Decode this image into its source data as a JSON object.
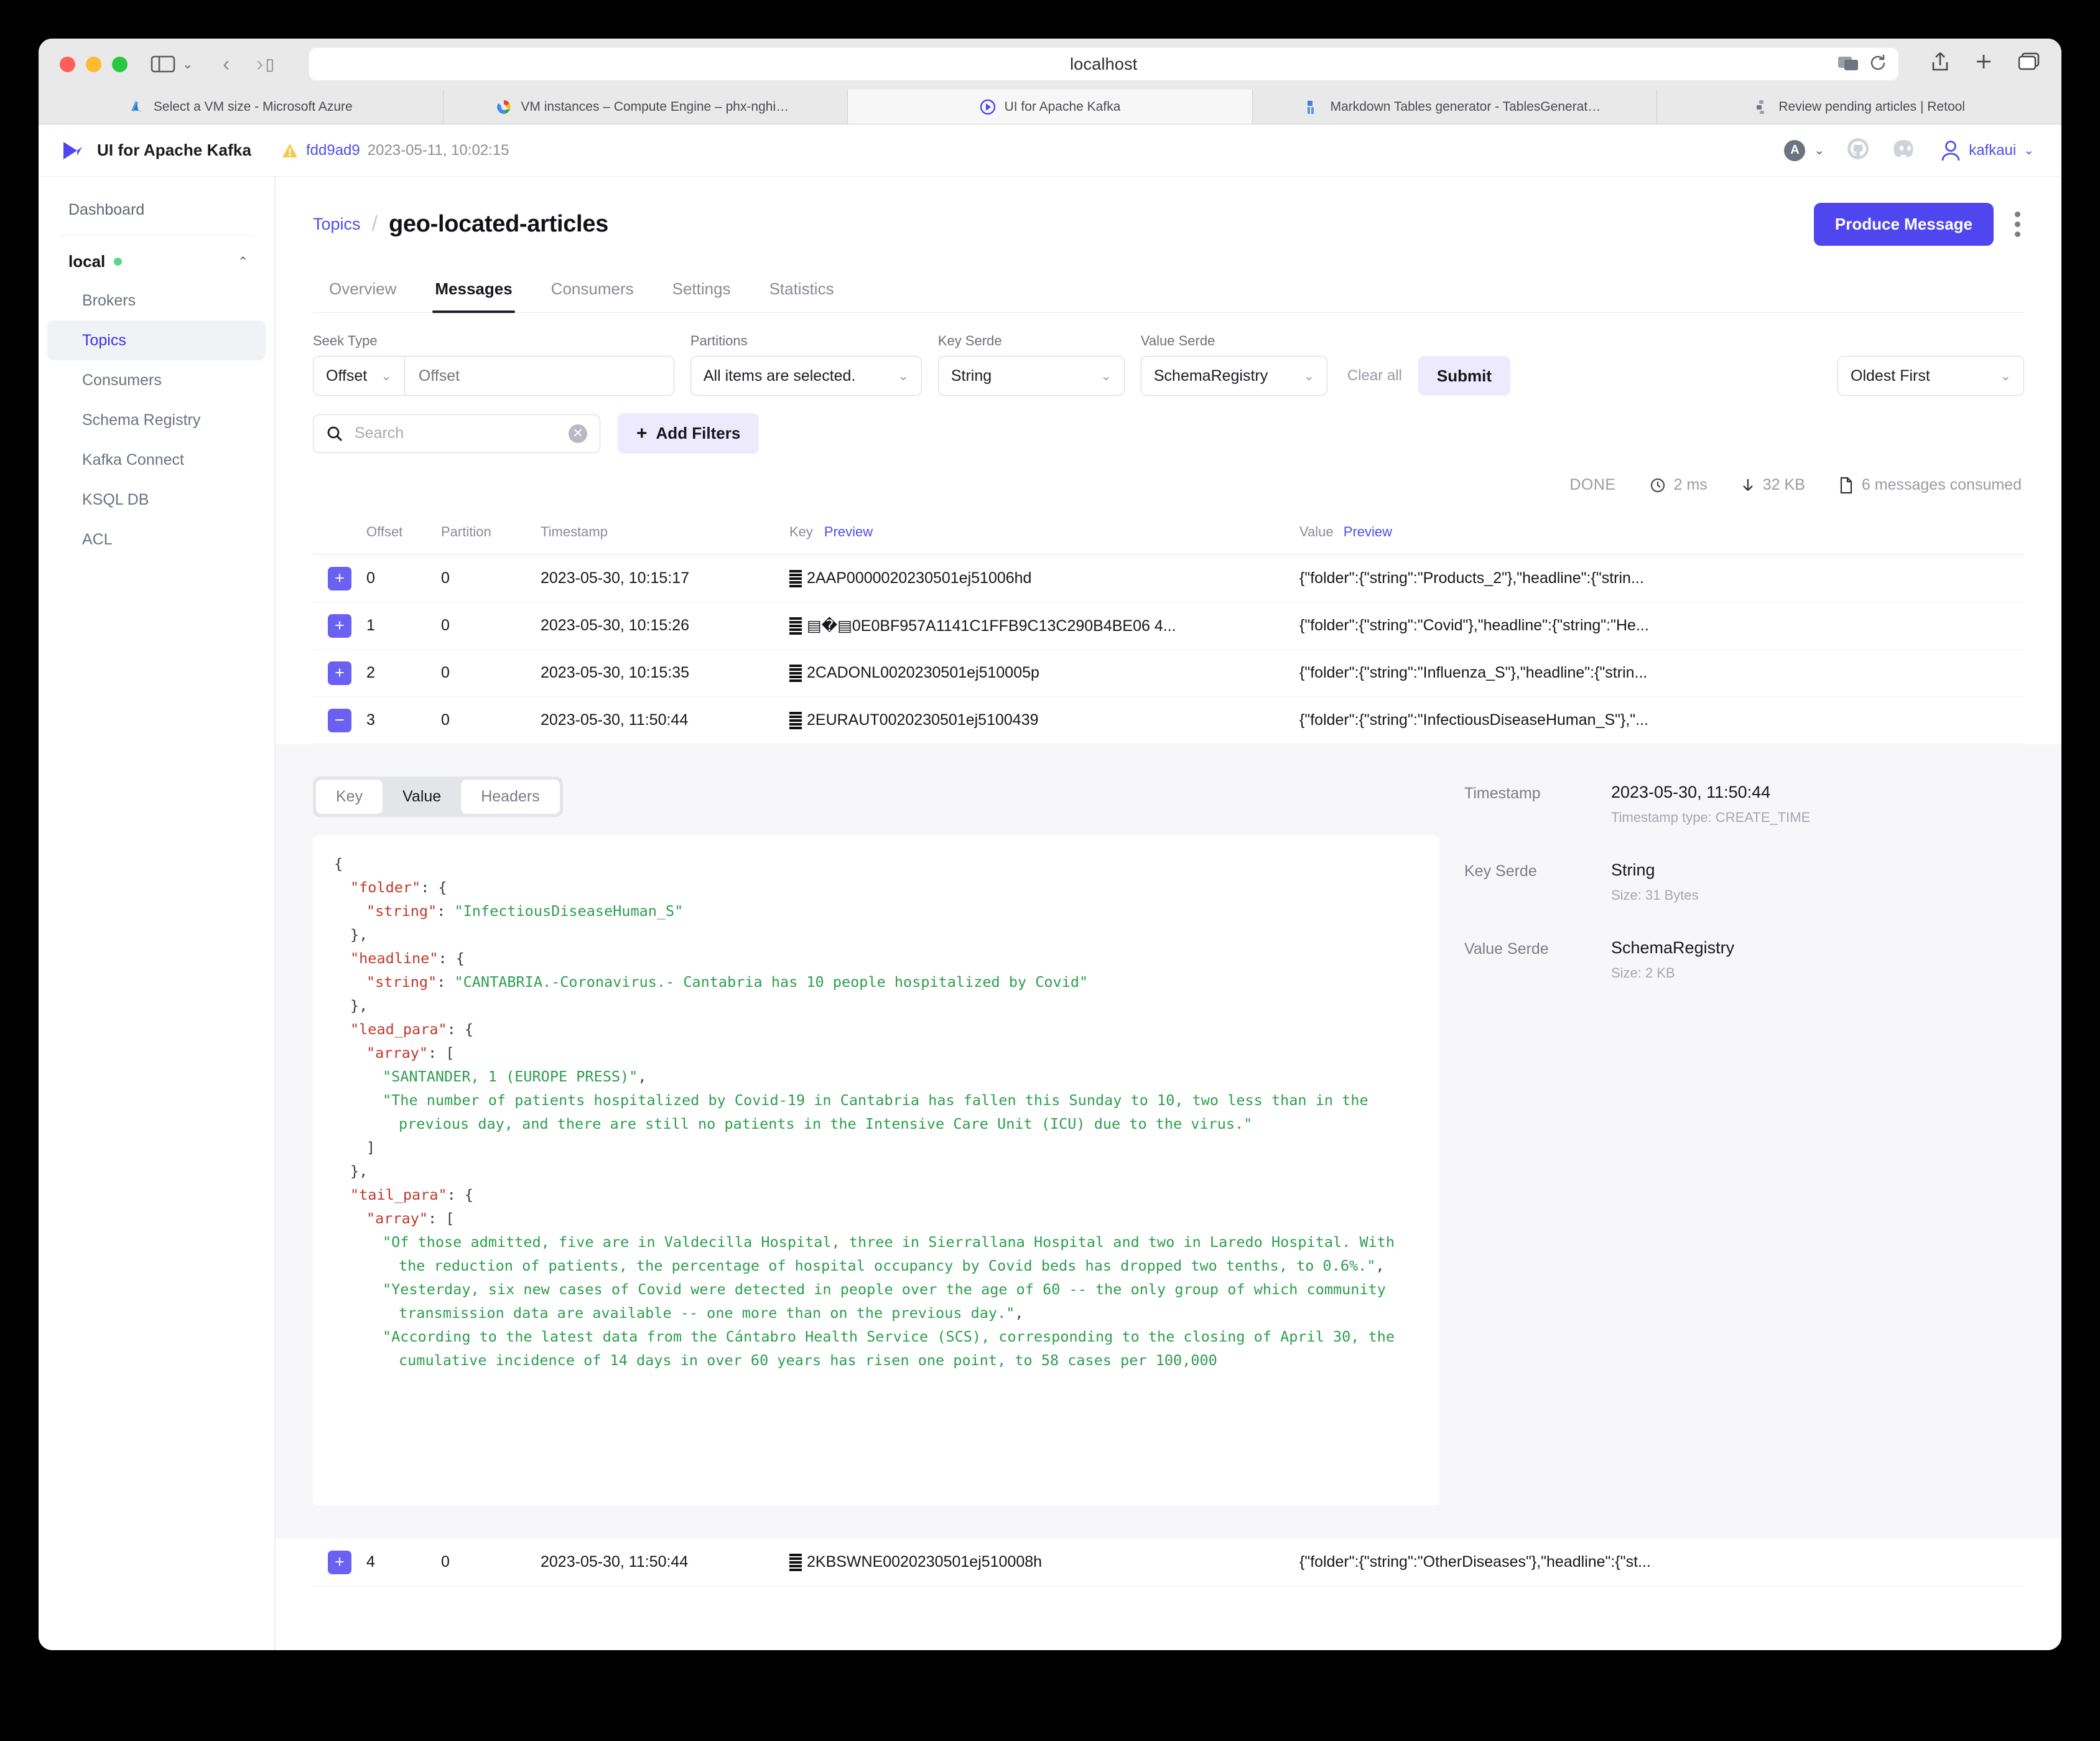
{
  "browser": {
    "url": "localhost",
    "tabs": [
      {
        "label": "Select a VM size - Microsoft Azure",
        "icon": "azure-icon",
        "active": false
      },
      {
        "label": "VM instances – Compute Engine – phx-nghiad...",
        "icon": "gcp-icon",
        "active": false
      },
      {
        "label": "UI for Apache Kafka",
        "icon": "kafka-ui-icon",
        "active": true
      },
      {
        "label": "Markdown Tables generator - TablesGenerator...",
        "icon": "tables-icon",
        "active": false
      },
      {
        "label": "Review pending articles | Retool",
        "icon": "retool-icon",
        "active": false
      }
    ]
  },
  "header": {
    "brand": "UI for Apache Kafka",
    "version_hash": "fdd9ad9",
    "version_date": "2023-05-11, 10:02:15",
    "avatar_letter": "A",
    "user": "kafkaui"
  },
  "sidebar": {
    "dashboard": "Dashboard",
    "cluster": "local",
    "items": [
      {
        "label": "Brokers",
        "active": false
      },
      {
        "label": "Topics",
        "active": true
      },
      {
        "label": "Consumers",
        "active": false
      },
      {
        "label": "Schema Registry",
        "active": false
      },
      {
        "label": "Kafka Connect",
        "active": false
      },
      {
        "label": "KSQL DB",
        "active": false
      },
      {
        "label": "ACL",
        "active": false
      }
    ]
  },
  "breadcrumb": {
    "parent": "Topics",
    "title": "geo-located-articles",
    "produce_label": "Produce Message"
  },
  "tabs": [
    {
      "label": "Overview",
      "active": false
    },
    {
      "label": "Messages",
      "active": true
    },
    {
      "label": "Consumers",
      "active": false
    },
    {
      "label": "Settings",
      "active": false
    },
    {
      "label": "Statistics",
      "active": false
    }
  ],
  "filters": {
    "seek_type_label": "Seek Type",
    "seek_type_value": "Offset",
    "seek_offset_placeholder": "Offset",
    "seek_offset_value": "",
    "partitions_label": "Partitions",
    "partitions_value": "All items are selected.",
    "key_serde_label": "Key Serde",
    "key_serde_value": "String",
    "value_serde_label": "Value Serde",
    "value_serde_value": "SchemaRegistry",
    "clear_all": "Clear all",
    "submit": "Submit",
    "sort_value": "Oldest First",
    "search_placeholder": "Search",
    "search_value": "",
    "add_filters": "Add Filters"
  },
  "status": {
    "state": "DONE",
    "elapsed": "2 ms",
    "bytes": "32 KB",
    "messages": "6 messages consumed"
  },
  "table": {
    "columns": {
      "offset": "Offset",
      "partition": "Partition",
      "timestamp": "Timestamp",
      "key": "Key",
      "key_preview": "Preview",
      "value": "Value",
      "value_preview": "Preview"
    },
    "rows": [
      {
        "offset": "0",
        "partition": "0",
        "timestamp": "2023-05-30, 10:15:17",
        "key": "2AAP0000020230501ej51006hd",
        "value": "{\"folder\":{\"string\":\"Products_2\"},\"headline\":{\"strin...",
        "expanded": false
      },
      {
        "offset": "1",
        "partition": "0",
        "timestamp": "2023-05-30, 10:15:26",
        "key": "▤�▤0E0BF957A1141C1FFB9C13C290B4BE06 4...",
        "value": "{\"folder\":{\"string\":\"Covid\"},\"headline\":{\"string\":\"He...",
        "expanded": false
      },
      {
        "offset": "2",
        "partition": "0",
        "timestamp": "2023-05-30, 10:15:35",
        "key": "2CADONL0020230501ej510005p",
        "value": "{\"folder\":{\"string\":\"Influenza_S\"},\"headline\":{\"strin...",
        "expanded": false
      },
      {
        "offset": "3",
        "partition": "0",
        "timestamp": "2023-05-30, 11:50:44",
        "key": "2EURAUT0020230501ej5100439",
        "value": "{\"folder\":{\"string\":\"InfectiousDiseaseHuman_S\"},\"...",
        "expanded": true
      },
      {
        "offset": "4",
        "partition": "0",
        "timestamp": "2023-05-30, 11:50:44",
        "key": "2KBSWNE0020230501ej510008h",
        "value": "{\"folder\":{\"string\":\"OtherDiseases\"},\"headline\":{\"st...",
        "expanded": false
      }
    ]
  },
  "detail": {
    "segments": [
      {
        "label": "Key",
        "active": false
      },
      {
        "label": "Value",
        "active": true
      },
      {
        "label": "Headers",
        "active": false
      }
    ],
    "json_lines": [
      {
        "indent": 0,
        "parts": [
          {
            "t": "{",
            "c": "p"
          }
        ]
      },
      {
        "indent": 1,
        "parts": [
          {
            "t": "\"folder\"",
            "c": "k"
          },
          {
            "t": ": {",
            "c": "p"
          }
        ]
      },
      {
        "indent": 2,
        "parts": [
          {
            "t": "\"string\"",
            "c": "k"
          },
          {
            "t": ": ",
            "c": "p"
          },
          {
            "t": "\"InfectiousDiseaseHuman_S\"",
            "c": "s"
          }
        ]
      },
      {
        "indent": 1,
        "parts": [
          {
            "t": "},",
            "c": "p"
          }
        ]
      },
      {
        "indent": 1,
        "parts": [
          {
            "t": "\"headline\"",
            "c": "k"
          },
          {
            "t": ": {",
            "c": "p"
          }
        ]
      },
      {
        "indent": 2,
        "parts": [
          {
            "t": "\"string\"",
            "c": "k"
          },
          {
            "t": ": ",
            "c": "p"
          },
          {
            "t": "\"CANTABRIA.-Coronavirus.- Cantabria has 10 people hospitalized by Covid\"",
            "c": "s"
          }
        ]
      },
      {
        "indent": 1,
        "parts": [
          {
            "t": "},",
            "c": "p"
          }
        ]
      },
      {
        "indent": 1,
        "parts": [
          {
            "t": "\"lead_para\"",
            "c": "k"
          },
          {
            "t": ": {",
            "c": "p"
          }
        ]
      },
      {
        "indent": 2,
        "parts": [
          {
            "t": "\"array\"",
            "c": "k"
          },
          {
            "t": ": [",
            "c": "p"
          }
        ]
      },
      {
        "indent": 3,
        "parts": [
          {
            "t": "\"SANTANDER, 1 (EUROPE PRESS)\"",
            "c": "s"
          },
          {
            "t": ",",
            "c": "p"
          }
        ]
      },
      {
        "indent": 3,
        "parts": [
          {
            "t": "\"The number of patients hospitalized by Covid-19 in Cantabria has fallen this Sunday to 10, two less than in the previous day, and there are still no patients in the Intensive Care Unit (ICU) due to the virus.\"",
            "c": "s"
          }
        ]
      },
      {
        "indent": 2,
        "parts": [
          {
            "t": "]",
            "c": "p"
          }
        ]
      },
      {
        "indent": 1,
        "parts": [
          {
            "t": "},",
            "c": "p"
          }
        ]
      },
      {
        "indent": 1,
        "parts": [
          {
            "t": "\"tail_para\"",
            "c": "k"
          },
          {
            "t": ": {",
            "c": "p"
          }
        ]
      },
      {
        "indent": 2,
        "parts": [
          {
            "t": "\"array\"",
            "c": "k"
          },
          {
            "t": ": [",
            "c": "p"
          }
        ]
      },
      {
        "indent": 3,
        "parts": [
          {
            "t": "\"Of those admitted, five are in Valdecilla Hospital, three in Sierrallana Hospital and two in Laredo Hospital. With the reduction of patients, the percentage of hospital occupancy by Covid beds has dropped two tenths, to 0.6%.\"",
            "c": "s"
          },
          {
            "t": ",",
            "c": "p"
          }
        ]
      },
      {
        "indent": 3,
        "parts": [
          {
            "t": "\"Yesterday, six new cases of Covid were detected in people over the age of 60 -- the only group of which community transmission data are available -- one more than on the previous day.\"",
            "c": "s"
          },
          {
            "t": ",",
            "c": "p"
          }
        ]
      },
      {
        "indent": 3,
        "parts": [
          {
            "t": "\"According to the latest data from the Cántabro Health Service (SCS), corresponding to the closing of April 30, the cumulative incidence of 14 days in over 60 years has risen one point, to 58 cases per 100,000",
            "c": "s"
          }
        ]
      }
    ],
    "meta": [
      {
        "label": "Timestamp",
        "value": "2023-05-30, 11:50:44",
        "sub": "Timestamp type: CREATE_TIME"
      },
      {
        "label": "Key Serde",
        "value": "String",
        "sub": "Size: 31 Bytes"
      },
      {
        "label": "Value Serde",
        "value": "SchemaRegistry",
        "sub": "Size: 2 KB"
      }
    ]
  },
  "colors": {
    "accent": "#4f46f0",
    "link": "#4f4fe8",
    "soft_accent_bg": "#eeeafe",
    "ok_dot": "#57d787"
  }
}
